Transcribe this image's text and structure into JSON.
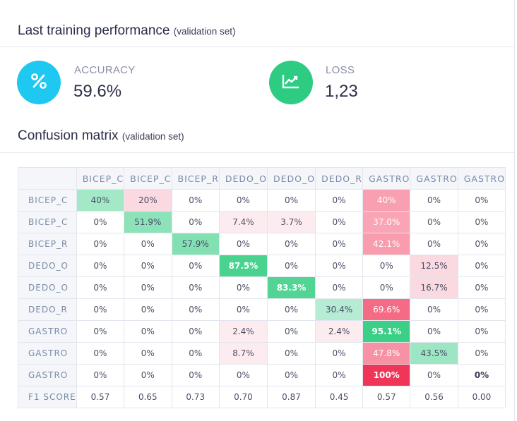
{
  "performance": {
    "title": "Last training performance",
    "subtitle": "(validation set)",
    "accuracy": {
      "label": "ACCURACY",
      "value": "59.6%",
      "icon": "percent-icon",
      "color": "#1ec8f0"
    },
    "loss": {
      "label": "LOSS",
      "value": "1,23",
      "icon": "trend-up-icon",
      "color": "#2ecc82"
    }
  },
  "confusion": {
    "title": "Confusion matrix",
    "subtitle": "(validation set)",
    "columns": [
      "BICEP_C",
      "BICEP_C",
      "BICEP_R",
      "DEDO_O",
      "DEDO_O",
      "DEDO_R",
      "GASTRO",
      "GASTRO",
      "GASTRO"
    ],
    "rows": [
      {
        "label": "BICEP_C",
        "cells": [
          "40%",
          "20%",
          "0%",
          "0%",
          "0%",
          "0%",
          "40%",
          "0%",
          "0%"
        ]
      },
      {
        "label": "BICEP_C",
        "cells": [
          "0%",
          "51.9%",
          "0%",
          "7.4%",
          "3.7%",
          "0%",
          "37.0%",
          "0%",
          "0%"
        ]
      },
      {
        "label": "BICEP_R",
        "cells": [
          "0%",
          "0%",
          "57.9%",
          "0%",
          "0%",
          "0%",
          "42.1%",
          "0%",
          "0%"
        ]
      },
      {
        "label": "DEDO_O",
        "cells": [
          "0%",
          "0%",
          "0%",
          "87.5%",
          "0%",
          "0%",
          "0%",
          "12.5%",
          "0%"
        ]
      },
      {
        "label": "DEDO_O",
        "cells": [
          "0%",
          "0%",
          "0%",
          "0%",
          "83.3%",
          "0%",
          "0%",
          "16.7%",
          "0%"
        ]
      },
      {
        "label": "DEDO_R",
        "cells": [
          "0%",
          "0%",
          "0%",
          "0%",
          "0%",
          "30.4%",
          "69.6%",
          "0%",
          "0%"
        ]
      },
      {
        "label": "GASTRO",
        "cells": [
          "0%",
          "0%",
          "0%",
          "2.4%",
          "0%",
          "2.4%",
          "95.1%",
          "0%",
          "0%"
        ]
      },
      {
        "label": "GASTRO",
        "cells": [
          "0%",
          "0%",
          "0%",
          "8.7%",
          "0%",
          "0%",
          "47.8%",
          "43.5%",
          "0%"
        ]
      },
      {
        "label": "GASTRO",
        "cells": [
          "0%",
          "0%",
          "0%",
          "0%",
          "0%",
          "0%",
          "100%",
          "0%",
          "0%"
        ]
      }
    ],
    "f1": {
      "label": "F1 SCORE",
      "cells": [
        "0.57",
        "0.65",
        "0.73",
        "0.70",
        "0.87",
        "0.45",
        "0.57",
        "0.56",
        "0.00"
      ]
    }
  }
}
